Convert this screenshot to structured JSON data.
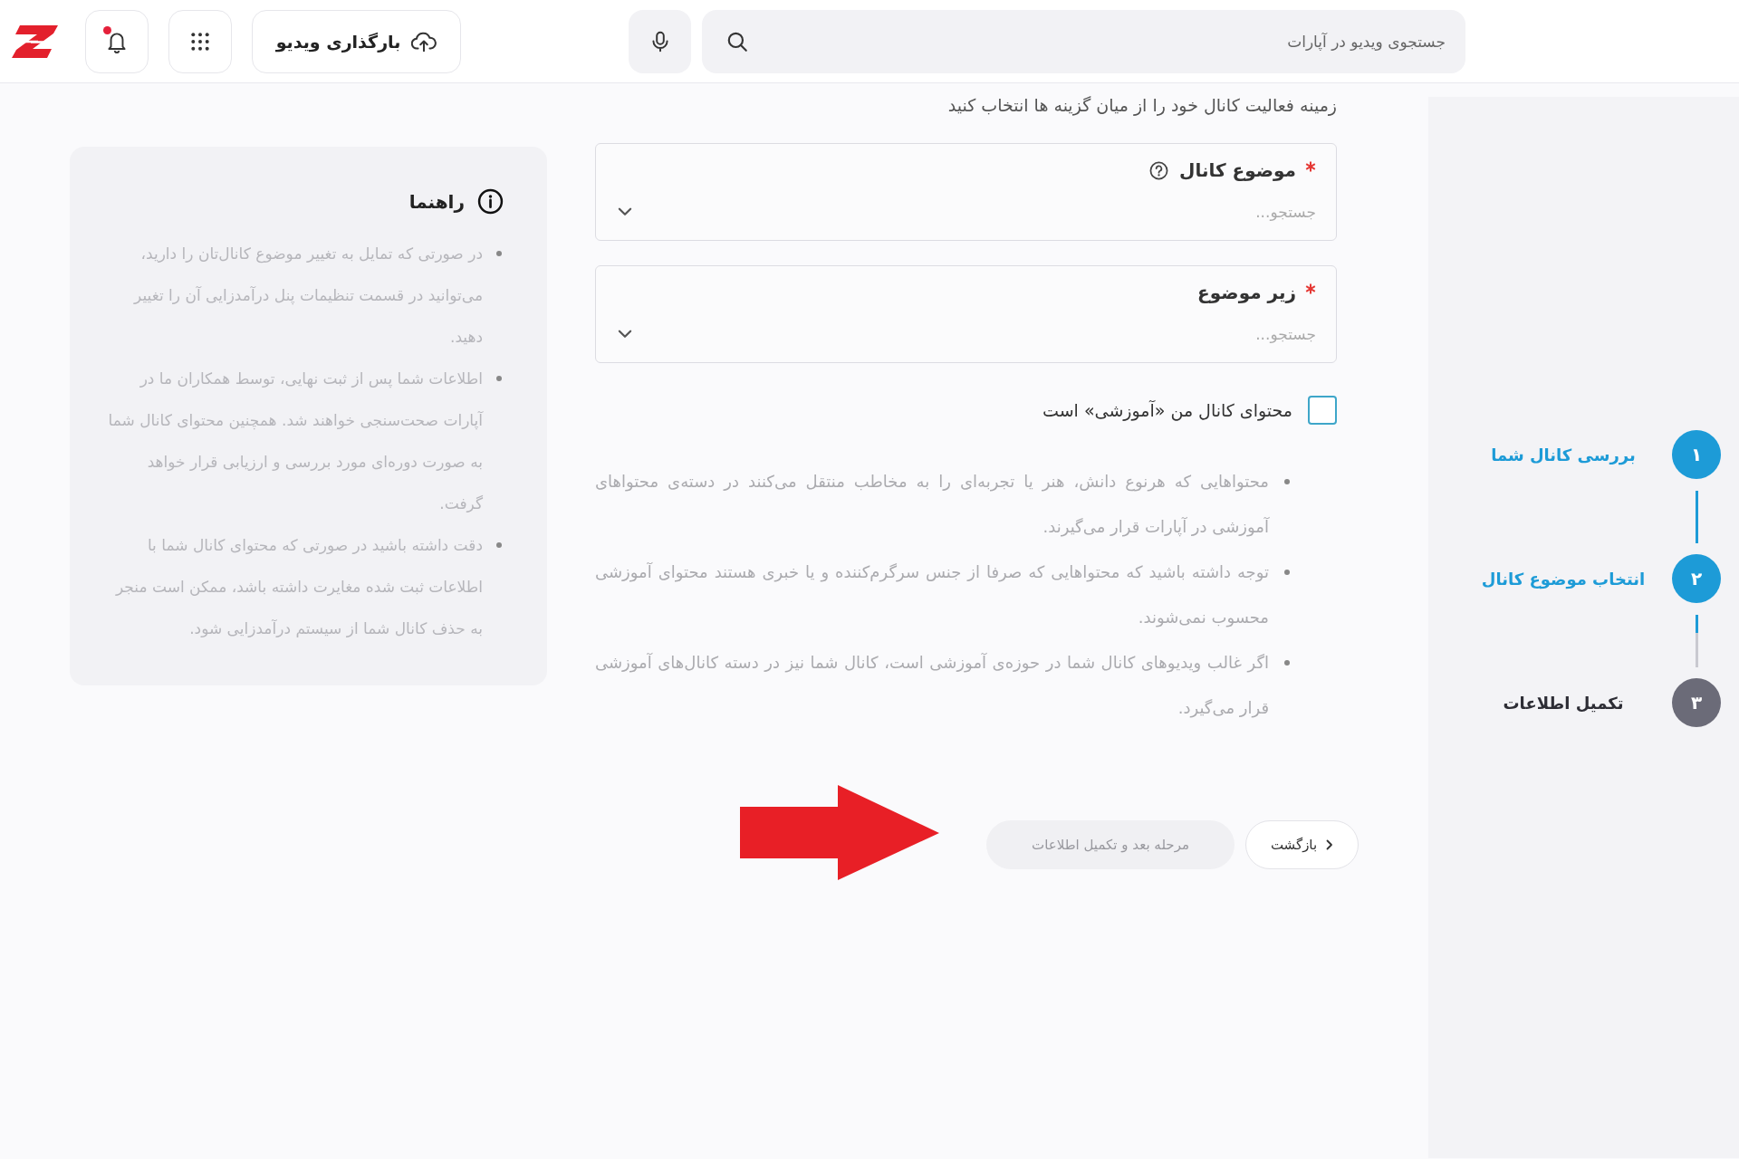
{
  "header": {
    "notifications": {
      "unread": true
    },
    "upload_button": {
      "label": "بارگذاری ویدیو"
    },
    "search": {
      "placeholder": "جستجوی ویدیو در آپارات"
    }
  },
  "steps": [
    {
      "number": "۱",
      "label": "بررسی کانال شما",
      "reached": true
    },
    {
      "number": "۲",
      "label": "انتخاب موضوع کانال",
      "reached": true
    },
    {
      "number": "۳",
      "label": "تکمیل اطلاعات",
      "reached": false
    }
  ],
  "connectors": [
    {
      "level": 1
    },
    {
      "level": 0.35
    }
  ],
  "form": {
    "instruction": "زمینه فعالیت کانال خود را از میان گزینه ها انتخاب کنید",
    "fields": [
      {
        "label": "موضوع کانال",
        "required": true,
        "help": true,
        "placeholder": "جستجو..."
      },
      {
        "label": "زیر موضوع",
        "required": true,
        "help": false,
        "placeholder": "جستجو..."
      }
    ],
    "educational_checkbox": {
      "label": "محتوای کانال من «آموزشی» است",
      "checked": false
    },
    "notes": [
      "محتواهایی که هرنوع دانش، هنر یا تجربه‌ای را به مخاطب منتقل می‌کنند در دسته‌ی محتواهای آموزشی در آپارات قرار می‌گیرند.",
      "توجه داشته باشید که محتواهایی که صرفا از جنس سرگرم‌کننده و یا خبری هستند محتوای آموزشی محسوب نمی‌شوند.",
      "اگر غالب ویدیوهای کانال شما در حوزه‌ی آموزشی است، کانال شما نیز در دسته کانال‌های آموزشی قرار می‌گیرد."
    ],
    "buttons": [
      {
        "kind": "back",
        "label": "بازگشت",
        "disabled": false
      },
      {
        "kind": "next",
        "label": "مرحله بعد و تکمیل اطلاعات",
        "disabled": true
      }
    ]
  },
  "guide": {
    "title": "راهنما",
    "items": [
      "در صورتی که تمایل به تغییر موضوع کانال‌تان را دارید، می‌توانید در قسمت تنظیمات پنل درآمدزایی آن را تغییر دهید.",
      "اطلاعات شما پس از ثبت نهایی، توسط همکاران ما در آپارات صحت‌سنجی خواهند شد. همچنین محتوای کانال شما به صورت دوره‌ای مورد بررسی و ارزیابی قرار خواهد گرفت.",
      "دقت داشته باشید در صورتی که محتوای کانال شما با اطلاعات ثبت شده مغایرت داشته باشد، ممکن است منجر به حذف کانال شما از سیستم درآمدزایی شود."
    ]
  }
}
